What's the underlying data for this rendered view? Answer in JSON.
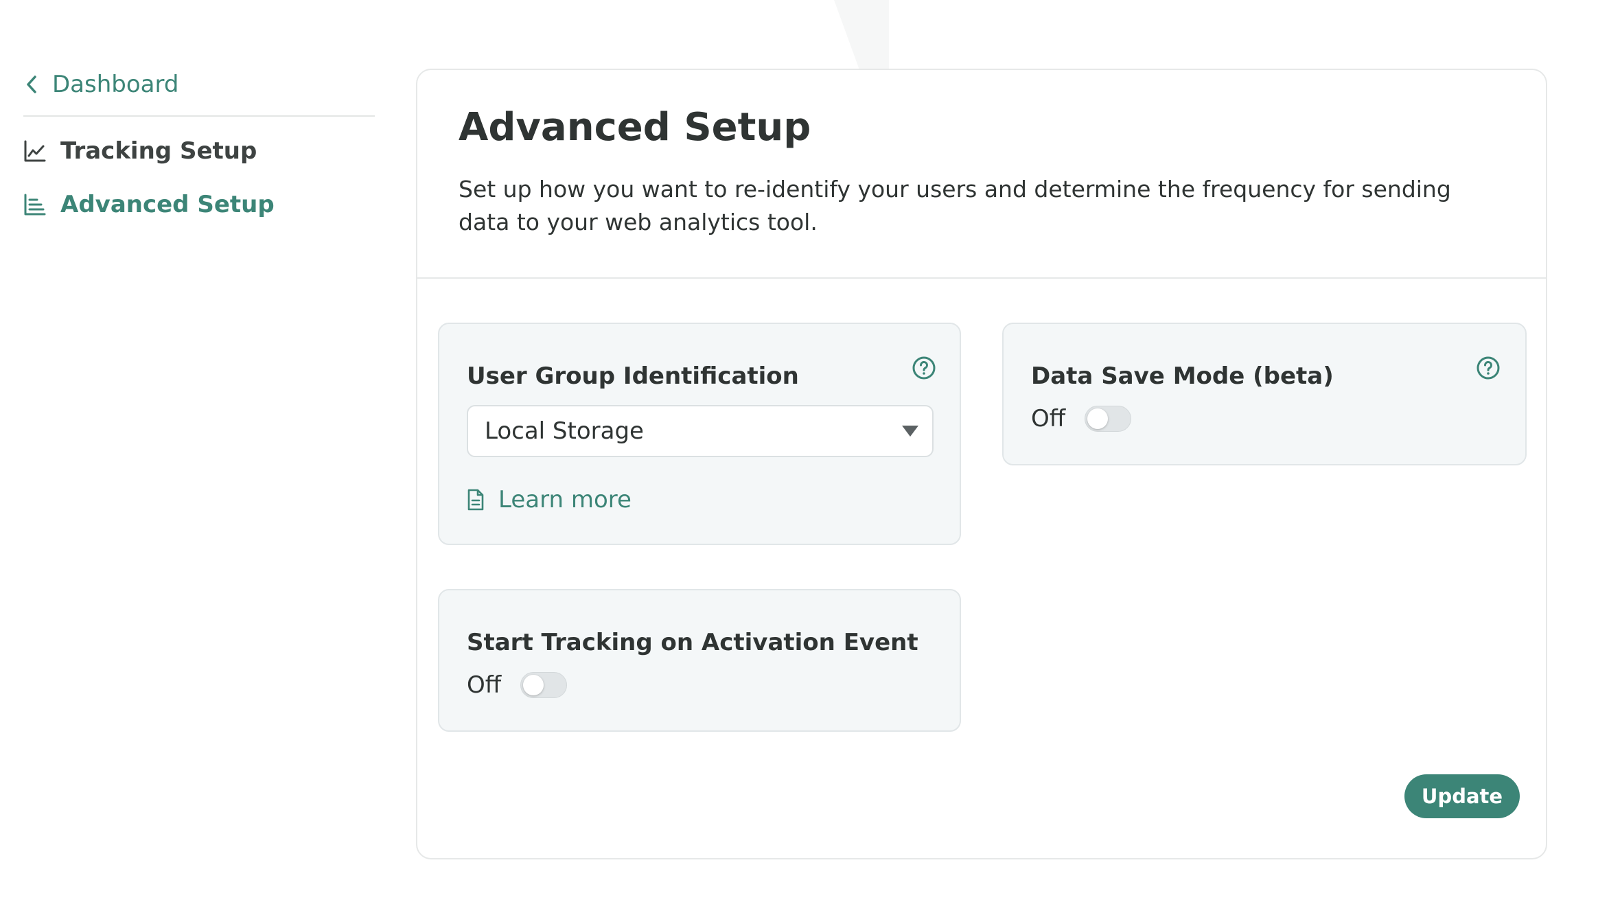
{
  "sidebar": {
    "back_label": "Dashboard",
    "items": [
      {
        "label": "Tracking Setup",
        "icon": "line-chart-icon",
        "active": false
      },
      {
        "label": "Advanced Setup",
        "icon": "bar-chart-icon",
        "active": true
      }
    ]
  },
  "header": {
    "title": "Advanced Setup",
    "description": "Set up how you want to re-identify your users and determine the frequency for sending data to your web analytics tool."
  },
  "user_group": {
    "title": "User Group Identification",
    "selected": "Local Storage",
    "learn_more": "Learn more"
  },
  "data_save_mode": {
    "title": "Data Save Mode (beta)",
    "state_label": "Off"
  },
  "activation_tracking": {
    "title": "Start Tracking on Activation Event",
    "state_label": "Off"
  },
  "actions": {
    "update_label": "Update"
  },
  "colors": {
    "accent": "#3c8577",
    "card_bg": "#f4f7f8",
    "text": "#2f3433"
  }
}
